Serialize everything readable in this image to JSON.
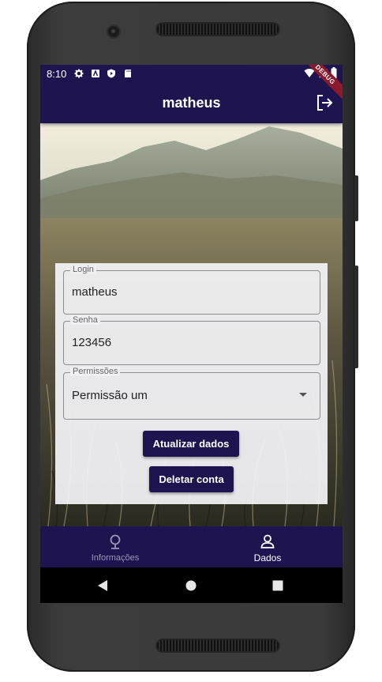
{
  "status_bar": {
    "time": "8:10",
    "debug_banner": "DEBUG"
  },
  "app_bar": {
    "title": "matheus"
  },
  "form": {
    "login": {
      "label": "Login",
      "value": "matheus"
    },
    "senha": {
      "label": "Senha",
      "value": "123456"
    },
    "permissoes": {
      "label": "Permissões",
      "selected": "Permissão um"
    },
    "update_button": "Atualizar dados",
    "delete_button": "Deletar conta"
  },
  "bottom_nav": {
    "items": [
      {
        "label": "Informações",
        "icon": "map-pin-icon",
        "active": false
      },
      {
        "label": "Dados",
        "icon": "person-icon",
        "active": true
      }
    ]
  },
  "colors": {
    "primary": "#1e1450",
    "inactive_nav": "#9c98b4"
  }
}
